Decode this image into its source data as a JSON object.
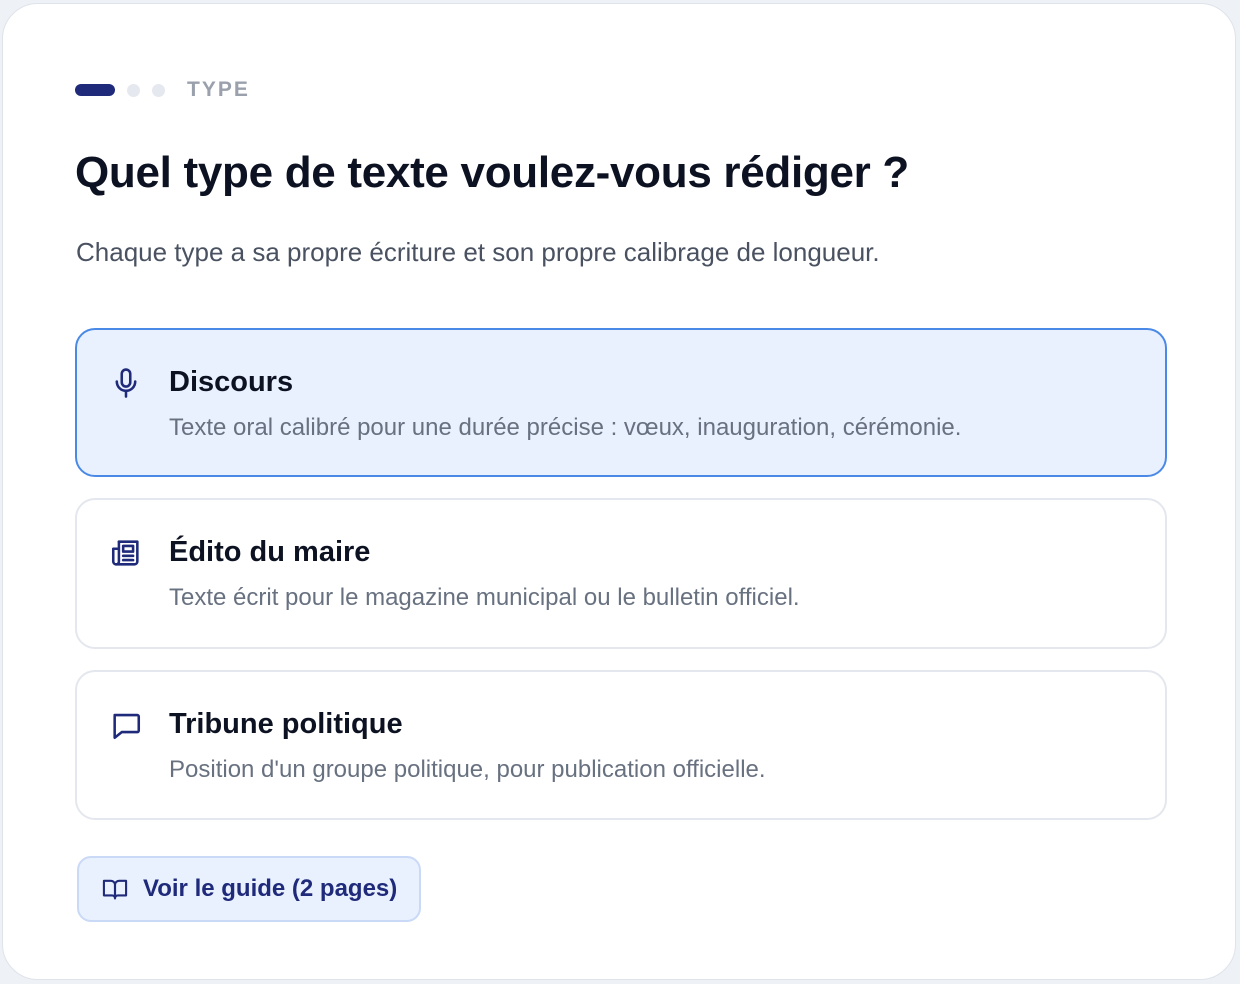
{
  "progress": {
    "step_label": "TYPE",
    "current_step": 1,
    "total_steps": 3
  },
  "header": {
    "title": "Quel type de texte voulez-vous rédiger ?",
    "subtitle": "Chaque type a sa propre écriture et son propre calibrage de longueur."
  },
  "options": [
    {
      "icon": "microphone-icon",
      "title": "Discours",
      "description": "Texte oral calibré pour une durée précise : vœux, inauguration, cérémonie.",
      "selected": true
    },
    {
      "icon": "newspaper-icon",
      "title": "Édito du maire",
      "description": "Texte écrit pour le magazine municipal ou le bulletin officiel.",
      "selected": false
    },
    {
      "icon": "speech-bubble-icon",
      "title": "Tribune politique",
      "description": "Position d'un groupe politique, pour publication officielle.",
      "selected": false
    }
  ],
  "guide_button": {
    "icon": "open-book-icon",
    "label": "Voir le guide (2 pages)"
  },
  "colors": {
    "accent": "#1f2a7a",
    "selected_border": "#4a8ae6",
    "selected_background": "#e9f1fe",
    "title_text": "#0d1222",
    "muted_text": "#687180"
  }
}
